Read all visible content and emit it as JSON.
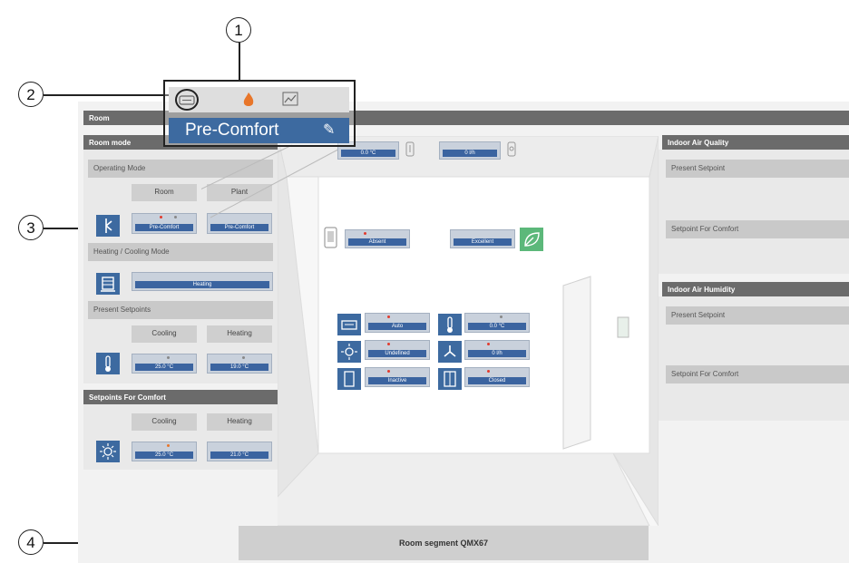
{
  "callouts": [
    "1",
    "2",
    "3",
    "4"
  ],
  "room_header": "Room",
  "left": {
    "room_mode_title": "Room mode",
    "operating_mode_label": "Operating Mode",
    "room_button": "Room",
    "plant_button": "Plant",
    "op_room_value": "Pre-Comfort",
    "op_plant_value": "Pre-Comfort",
    "heat_cool_label": "Heating / Cooling Mode",
    "heat_cool_value": "Heating",
    "present_setpoints_label": "Present Setpoints",
    "cooling_label": "Cooling",
    "heating_label": "Heating",
    "present_cooling_value": "25.0 °C",
    "present_heating_value": "19.0 °C",
    "comfort_title": "Setpoints For Comfort",
    "comfort_cooling_label": "Cooling",
    "comfort_heating_label": "Heating",
    "comfort_cooling_value": "25.0 °C",
    "comfort_heating_value": "21.0 °C"
  },
  "popup": {
    "mode_value": "Pre-Comfort",
    "pencil": "✎"
  },
  "top_values": {
    "temp": "0.0 °C",
    "flow": "0 l/h"
  },
  "room_view": {
    "presence_value": "Absent",
    "eco_value": "Excellent",
    "fan_value": "Auto",
    "temp_value": "0.0 °C",
    "light_value": "Undefined",
    "air_value": "0 l/h",
    "window_value": "Inactive",
    "door_value": "Closed",
    "segment_label": "Room segment QMX67"
  },
  "right": {
    "iaq_title": "Indoor Air Quality",
    "iaq_present": "Present Setpoint",
    "iaq_comfort": "Setpoint For Comfort",
    "hum_title": "Indoor Air Humidity",
    "hum_present": "Present Setpoint",
    "hum_comfort": "Setpoint For Comfort"
  },
  "colors": {
    "accent_blue": "#3d6aa0",
    "header_dark": "#6b6b6b",
    "eco_green": "#5cb87a",
    "alert_red": "#e23b2e",
    "flame_orange": "#e8762a"
  }
}
